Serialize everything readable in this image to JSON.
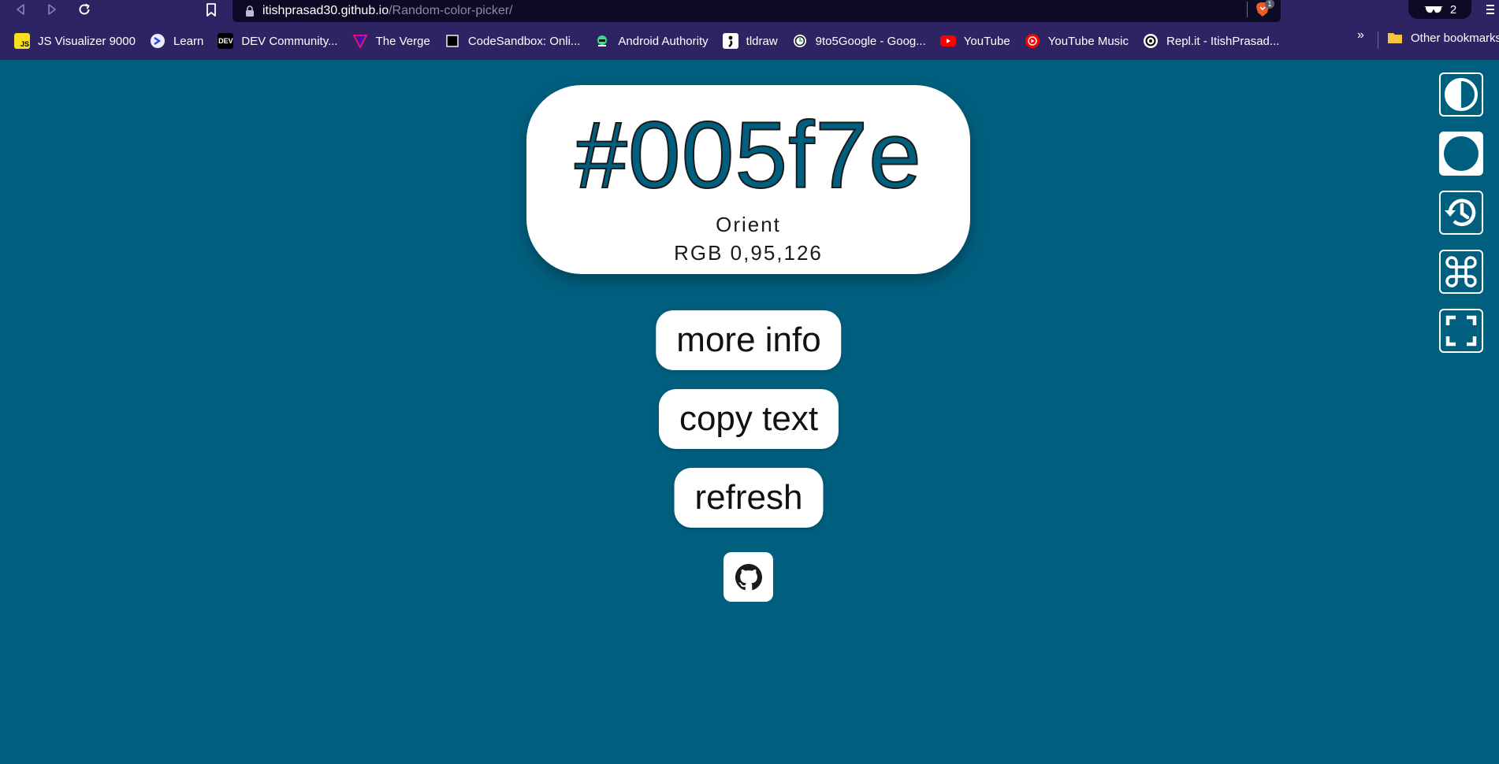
{
  "browser": {
    "url_host": "itishprasad30.github.io",
    "url_path": "/Random-color-picker/",
    "shields_count": "1",
    "incognito_count": "2",
    "bookmarks": [
      {
        "label": "JS Visualizer 9000",
        "icon": "js-icon",
        "icon_text": "JS"
      },
      {
        "label": "Learn",
        "icon": "learn-icon",
        "icon_text": ""
      },
      {
        "label": "DEV Community...",
        "icon": "dev-icon",
        "icon_text": "DEV"
      },
      {
        "label": "The Verge",
        "icon": "verge-icon",
        "icon_text": ""
      },
      {
        "label": "CodeSandbox: Onli...",
        "icon": "codesandbox-icon",
        "icon_text": ""
      },
      {
        "label": "Android Authority",
        "icon": "android-icon",
        "icon_text": ""
      },
      {
        "label": "tldraw",
        "icon": "tldraw-icon",
        "icon_text": ""
      },
      {
        "label": "9to5Google - Goog...",
        "icon": "9to5google-icon",
        "icon_text": ""
      },
      {
        "label": "YouTube",
        "icon": "youtube-icon",
        "icon_text": ""
      },
      {
        "label": "YouTube Music",
        "icon": "youtube-music-icon",
        "icon_text": ""
      },
      {
        "label": "Repl.it - ItishPrasad...",
        "icon": "replit-icon",
        "icon_text": ""
      }
    ],
    "more_label": "»",
    "other_bookmarks_label": "Other bookmarks"
  },
  "color": {
    "hex": "#005f7e",
    "name": "Orient",
    "rgb": "RGB 0,95,126",
    "background": "#005f7e"
  },
  "actions": {
    "more_info": "more info",
    "copy_text": "copy text",
    "refresh": "refresh"
  },
  "sidebar": [
    {
      "icon": "contrast-icon"
    },
    {
      "icon": "circle-icon"
    },
    {
      "icon": "history-icon"
    },
    {
      "icon": "command-icon"
    },
    {
      "icon": "fullscreen-icon"
    }
  ],
  "footer": {
    "icon": "github-icon"
  }
}
